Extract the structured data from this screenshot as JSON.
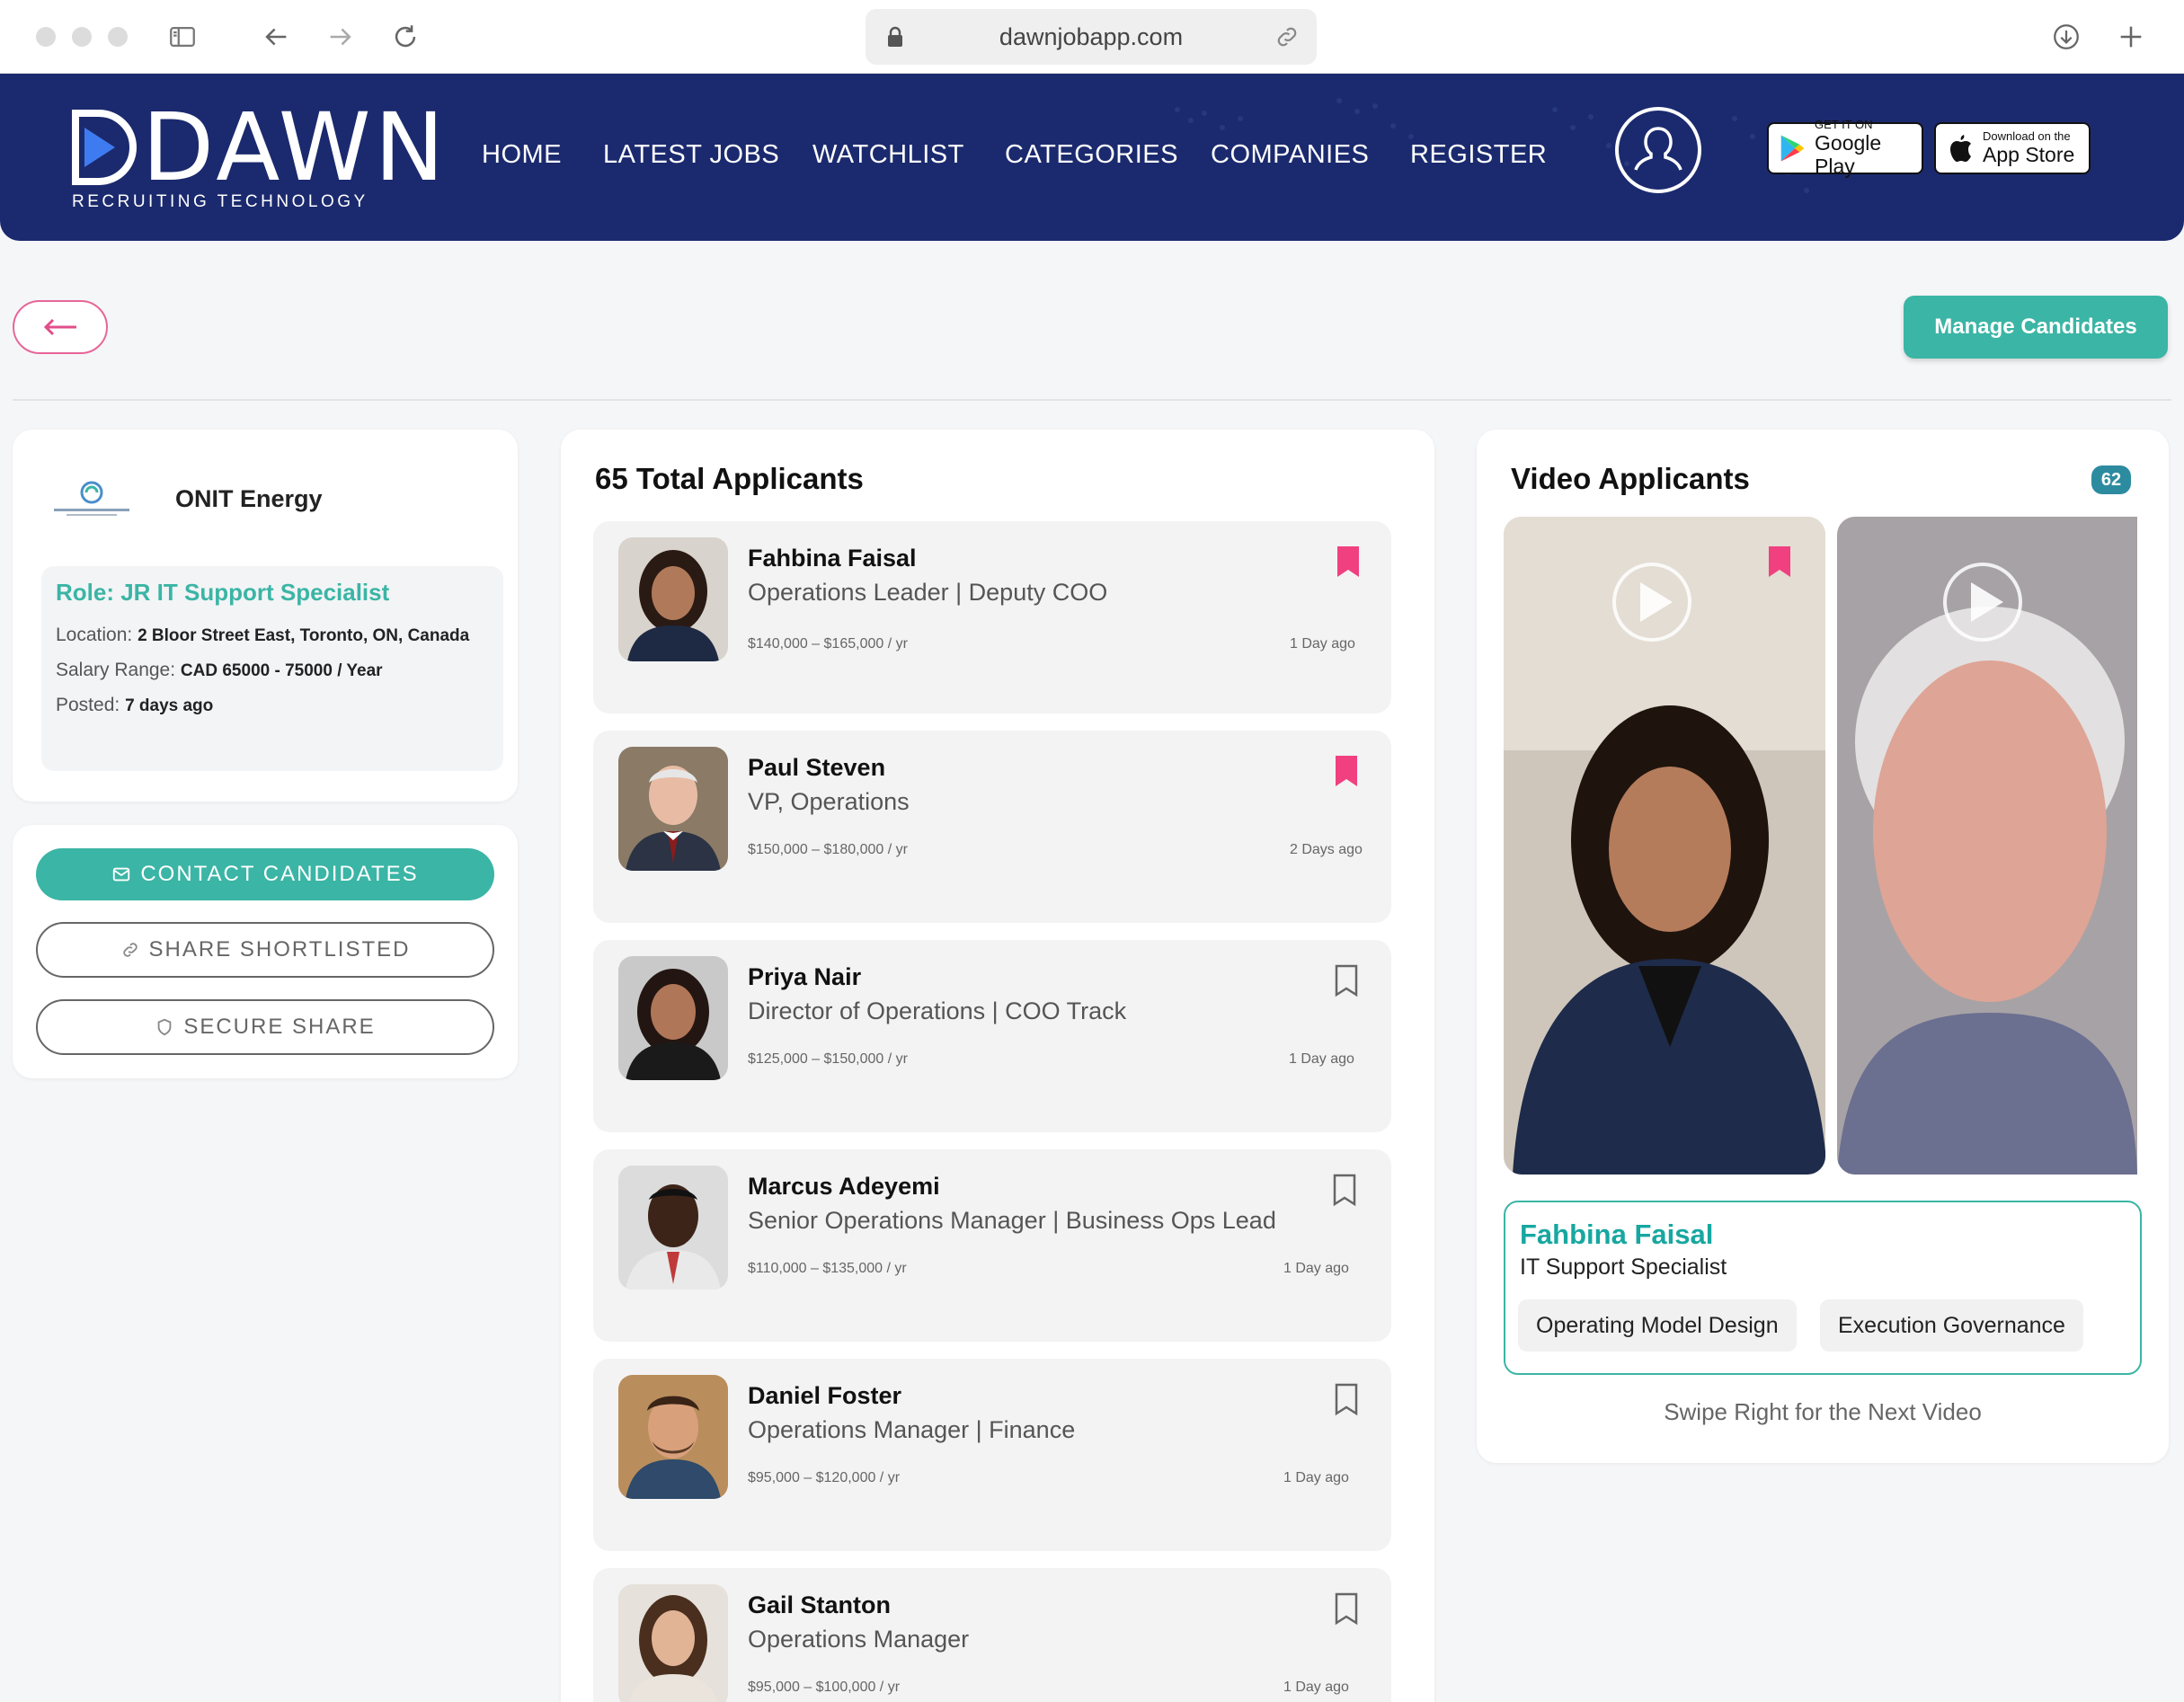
{
  "browser": {
    "url": "dawnjobapp.com"
  },
  "brand": {
    "name": "DAWN",
    "tagline": "RECRUITING TECHNOLOGY"
  },
  "nav": [
    {
      "label": "HOME"
    },
    {
      "label": "LATEST JOBS"
    },
    {
      "label": "WATCHLIST"
    },
    {
      "label": "CATEGORIES"
    },
    {
      "label": "COMPANIES"
    },
    {
      "label": "REGISTER"
    }
  ],
  "stores": {
    "google": {
      "small": "GET IT ON",
      "big": "Google Play"
    },
    "apple": {
      "small": "Download on the",
      "big": "App Store"
    }
  },
  "toolbar": {
    "manage_label": "Manage Candidates"
  },
  "job": {
    "company": "ONIT Energy",
    "role": "Role: JR IT Support Specialist",
    "location_label": "Location:",
    "location": "2 Bloor Street East, Toronto, ON, Canada",
    "salary_label": "Salary Range:",
    "salary": "CAD 65000 - 75000 / Year",
    "posted_label": "Posted:",
    "posted": "7 days ago"
  },
  "actions": {
    "contact": "CONTACT CANDIDATES",
    "share_shortlisted": "SHARE SHORTLISTED",
    "secure_share": "SECURE SHARE"
  },
  "applicants": {
    "title": "65 Total Applicants",
    "items": [
      {
        "name": "Fahbina Faisal",
        "title": "Operations Leader | Deputy COO",
        "salary": "$140,000 – $165,000 / yr",
        "time": "1 Day ago",
        "bookmarked": true
      },
      {
        "name": "Paul Steven",
        "title": "VP, Operations",
        "salary": "$150,000 – $180,000 / yr",
        "time": "2 Days ago",
        "bookmarked": true
      },
      {
        "name": "Priya Nair",
        "title": "Director of Operations | COO Track",
        "salary": "$125,000 – $150,000 / yr",
        "time": "1 Day ago",
        "bookmarked": false
      },
      {
        "name": "Marcus Adeyemi",
        "title": "Senior Operations Manager | Business Ops Lead",
        "salary": "$110,000 – $135,000 / yr",
        "time": "1 Day ago",
        "bookmarked": false
      },
      {
        "name": "Daniel Foster",
        "title": "Operations Manager | Finance",
        "salary": "$95,000 – $120,000 / yr",
        "time": "1 Day ago",
        "bookmarked": false
      },
      {
        "name": "Gail Stanton",
        "title": "Operations Manager",
        "salary": "$95,000 – $100,000 / yr",
        "time": "1 Day ago",
        "bookmarked": false
      }
    ]
  },
  "video": {
    "title": "Video Applicants",
    "count": "62",
    "current": {
      "name": "Fahbina Faisal",
      "role": "IT Support Specialist",
      "skills": [
        "Operating Model Design",
        "Execution Governance"
      ]
    },
    "hint": "Swipe Right for the Next Video"
  },
  "colors": {
    "header_bg": "#1b2a6e",
    "accent_teal": "#3bb5a5",
    "bookmark_pink": "#f0407f",
    "back_pink": "#e76598"
  }
}
